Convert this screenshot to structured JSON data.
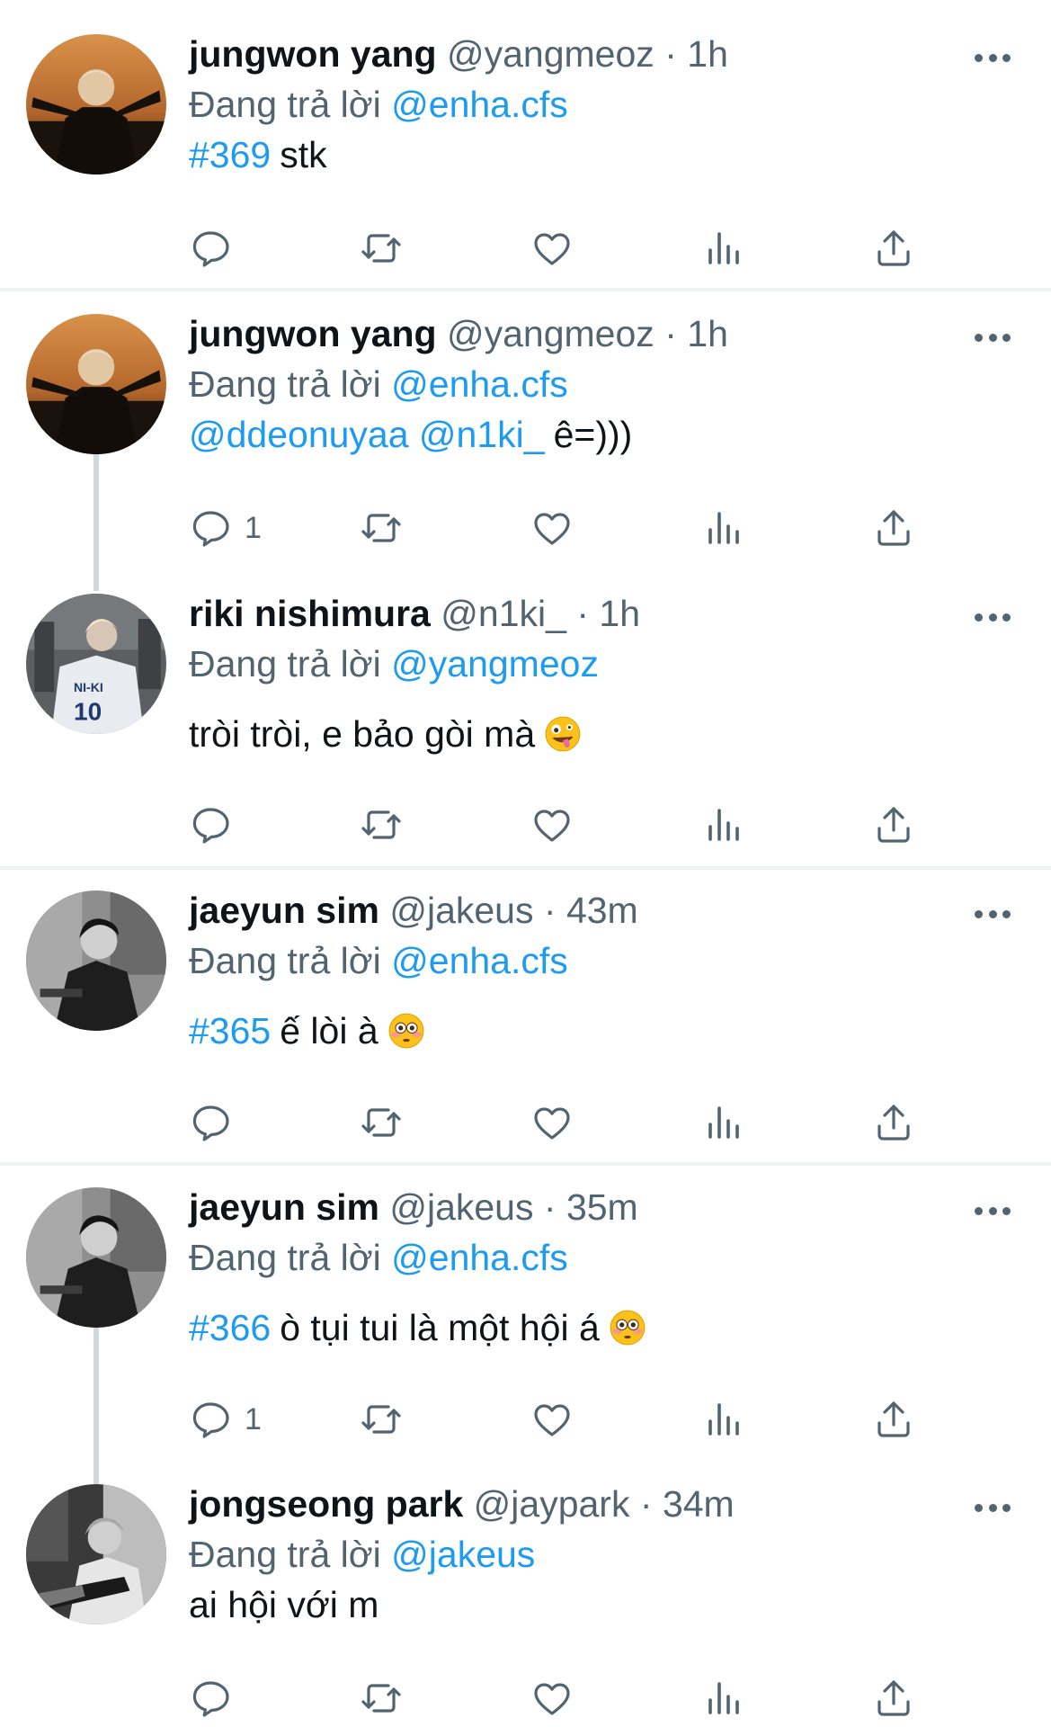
{
  "colors": {
    "accent": "#1d9bf0",
    "secondary": "#536471",
    "text": "#0f1419",
    "divider": "#eff3f4",
    "thread": "#cfd9de"
  },
  "tweets": [
    {
      "name": "jungwon yang",
      "handle": "@yangmeoz",
      "sep": "·",
      "time": "1h",
      "reply_prefix": "Đang trả lời",
      "reply_to": "@enha.cfs",
      "text_blue": "#369",
      "text_plain": "stk",
      "emoji": "",
      "reply_count": ""
    },
    {
      "name": "jungwon yang",
      "handle": "@yangmeoz",
      "sep": "·",
      "time": "1h",
      "reply_prefix": "Đang trả lời",
      "reply_to": "@enha.cfs",
      "text_blue": "@ddeonuyaa @n1ki_",
      "text_plain": "ê=)))",
      "emoji": "",
      "reply_count": "1"
    },
    {
      "name": "riki nishimura",
      "handle": "@n1ki_",
      "sep": "·",
      "time": "1h",
      "reply_prefix": "Đang trả lời",
      "reply_to": "@yangmeoz",
      "text_blue": "",
      "text_plain": "tròi tròi, e bảo gòi mà",
      "emoji": "zany-face",
      "reply_count": ""
    },
    {
      "name": "jaeyun sim",
      "handle": "@jakeus",
      "sep": "·",
      "time": "43m",
      "reply_prefix": "Đang trả lời",
      "reply_to": "@enha.cfs",
      "text_blue": "#365",
      "text_plain": "ế lòi à",
      "emoji": "flushed-face",
      "reply_count": ""
    },
    {
      "name": "jaeyun sim",
      "handle": "@jakeus",
      "sep": "·",
      "time": "35m",
      "reply_prefix": "Đang trả lời",
      "reply_to": "@enha.cfs",
      "text_blue": "#366",
      "text_plain": "ò tụi tui là một hội á",
      "emoji": "flushed-face",
      "reply_count": "1"
    },
    {
      "name": "jongseong park",
      "handle": "@jaypark",
      "sep": "·",
      "time": "34m",
      "reply_prefix": "Đang trả lời",
      "reply_to": "@jakeus",
      "text_blue": "",
      "text_plain": "ai hội với m",
      "emoji": "",
      "reply_count": ""
    }
  ]
}
